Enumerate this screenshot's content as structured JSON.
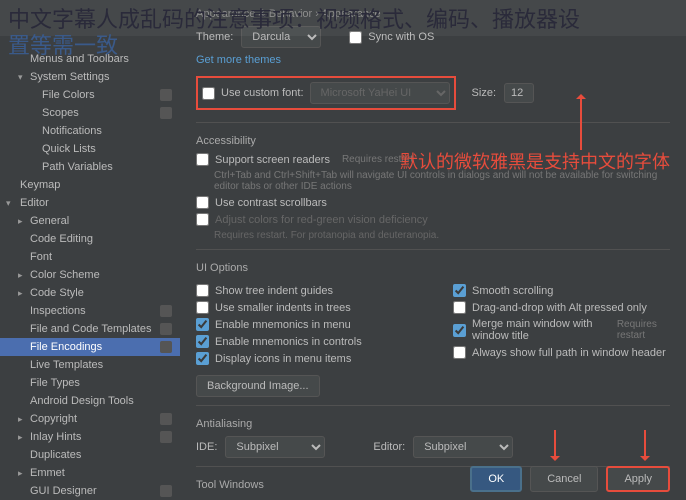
{
  "overlay": {
    "title": "中文字幕人成乱码的注意事项：视频格式、编码、播放器设",
    "sub": "置等需一致"
  },
  "sidebar": {
    "items": [
      {
        "label": "Menus and Toolbars",
        "lvl": 1,
        "chev": ""
      },
      {
        "label": "System Settings",
        "lvl": 1,
        "chev": "▾"
      },
      {
        "label": "File Colors",
        "lvl": 2,
        "badge": true
      },
      {
        "label": "Scopes",
        "lvl": 2,
        "badge": true
      },
      {
        "label": "Notifications",
        "lvl": 2
      },
      {
        "label": "Quick Lists",
        "lvl": 2
      },
      {
        "label": "Path Variables",
        "lvl": 2
      },
      {
        "label": "Keymap",
        "lvl": 0
      },
      {
        "label": "Editor",
        "lvl": 0,
        "chev": "▾"
      },
      {
        "label": "General",
        "lvl": 1,
        "chev": "▸"
      },
      {
        "label": "Code Editing",
        "lvl": 1
      },
      {
        "label": "Font",
        "lvl": 1
      },
      {
        "label": "Color Scheme",
        "lvl": 1,
        "chev": "▸"
      },
      {
        "label": "Code Style",
        "lvl": 1,
        "chev": "▸"
      },
      {
        "label": "Inspections",
        "lvl": 1,
        "badge": true
      },
      {
        "label": "File and Code Templates",
        "lvl": 1,
        "badge": true
      },
      {
        "label": "File Encodings",
        "lvl": 1,
        "sel": true,
        "badge": true
      },
      {
        "label": "Live Templates",
        "lvl": 1
      },
      {
        "label": "File Types",
        "lvl": 1
      },
      {
        "label": "Android Design Tools",
        "lvl": 1
      },
      {
        "label": "Copyright",
        "lvl": 1,
        "chev": "▸",
        "badge": true
      },
      {
        "label": "Inlay Hints",
        "lvl": 1,
        "chev": "▸",
        "badge": true
      },
      {
        "label": "Duplicates",
        "lvl": 1
      },
      {
        "label": "Emmet",
        "lvl": 1,
        "chev": "▸"
      },
      {
        "label": "GUI Designer",
        "lvl": 1,
        "badge": true
      }
    ]
  },
  "content": {
    "crumb": "Appearance & Behavior › Appearance",
    "theme": {
      "label": "Theme:",
      "value": "Darcula",
      "sync": "Sync with OS"
    },
    "getmore": "Get more themes",
    "font": {
      "chk": "Use custom font:",
      "value": "Microsoft YaHei UI",
      "sizeLabel": "Size:",
      "size": "12"
    },
    "access": {
      "title": "Accessibility",
      "sr": "Support screen readers",
      "srHint": "Requires restart",
      "srDesc": "Ctrl+Tab and Ctrl+Shift+Tab will navigate UI controls in dialogs and will not be available for switching editor tabs or other IDE actions",
      "contrast": "Use contrast scrollbars",
      "adjust": "Adjust colors for red-green vision deficiency",
      "adjustHint": "Requires restart. For protanopia and deuteranopia."
    },
    "ui": {
      "title": "UI Options",
      "opts": [
        [
          "Show tree indent guides",
          false
        ],
        [
          "Smooth scrolling",
          true
        ],
        [
          "Use smaller indents in trees",
          false
        ],
        [
          "Drag-and-drop with Alt pressed only",
          false
        ],
        [
          "Enable mnemonics in menu",
          true
        ],
        [
          "Merge main window with window title",
          true
        ],
        [
          "Enable mnemonics in controls",
          true
        ],
        [
          "Always show full path in window header",
          false
        ],
        [
          "Display icons in menu items",
          true
        ]
      ],
      "mergeHint": "Requires restart",
      "bg": "Background Image..."
    },
    "aa": {
      "title": "Antialiasing",
      "ide": "IDE:",
      "ideVal": "Subpixel",
      "ed": "Editor:",
      "edVal": "Subpixel"
    },
    "tw": "Tool Windows"
  },
  "annotation": "默认的微软雅黑是支持中文的字体",
  "buttons": {
    "ok": "OK",
    "cancel": "Cancel",
    "apply": "Apply"
  }
}
